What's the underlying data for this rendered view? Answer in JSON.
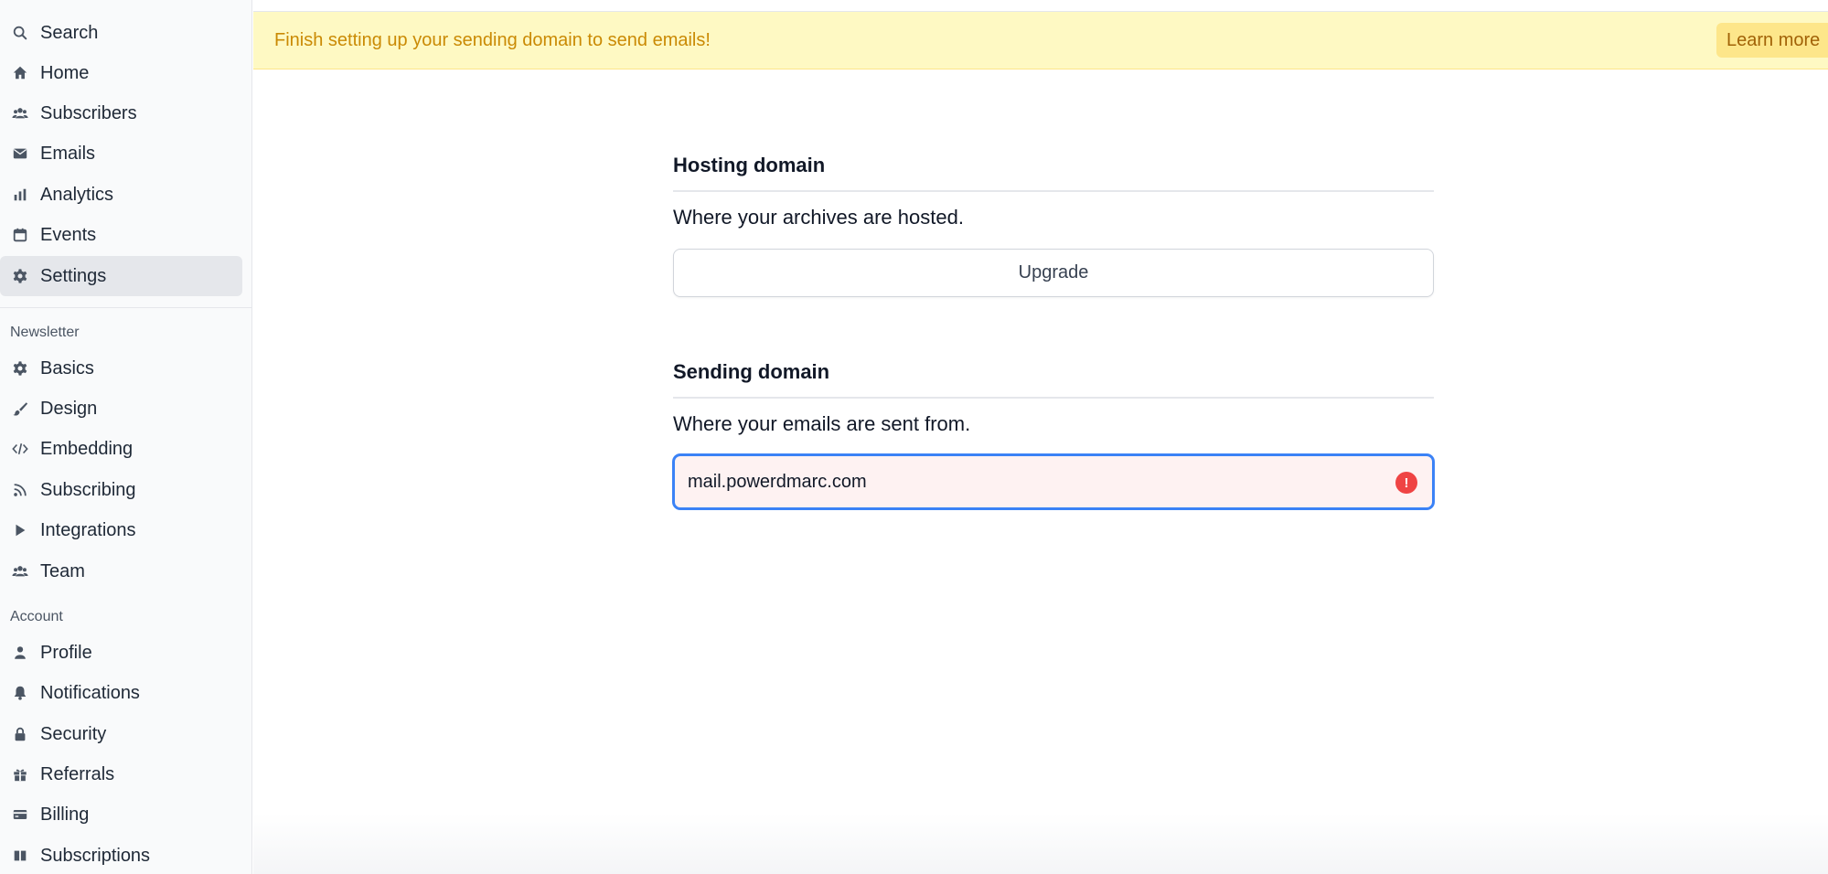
{
  "sidebar": {
    "main_items": [
      {
        "label": "Search",
        "icon": "search-icon"
      },
      {
        "label": "Home",
        "icon": "home-icon"
      },
      {
        "label": "Subscribers",
        "icon": "users-icon"
      },
      {
        "label": "Emails",
        "icon": "envelope-icon"
      },
      {
        "label": "Analytics",
        "icon": "bar-chart-icon"
      },
      {
        "label": "Events",
        "icon": "calendar-icon"
      },
      {
        "label": "Settings",
        "icon": "gear-icon",
        "active": true
      }
    ],
    "newsletter_heading": "Newsletter",
    "newsletter_items": [
      {
        "label": "Basics",
        "icon": "gear-icon"
      },
      {
        "label": "Design",
        "icon": "brush-icon"
      },
      {
        "label": "Embedding",
        "icon": "code-icon"
      },
      {
        "label": "Subscribing",
        "icon": "rss-icon"
      },
      {
        "label": "Integrations",
        "icon": "play-icon"
      },
      {
        "label": "Team",
        "icon": "users-icon"
      }
    ],
    "account_heading": "Account",
    "account_items": [
      {
        "label": "Profile",
        "icon": "user-icon"
      },
      {
        "label": "Notifications",
        "icon": "bell-icon"
      },
      {
        "label": "Security",
        "icon": "lock-icon"
      },
      {
        "label": "Referrals",
        "icon": "gift-icon"
      },
      {
        "label": "Billing",
        "icon": "credit-card-icon"
      },
      {
        "label": "Subscriptions",
        "icon": "columns-icon"
      }
    ]
  },
  "banner": {
    "message": "Finish setting up your sending domain to send emails!",
    "button_label": "Learn more"
  },
  "hosting": {
    "title": "Hosting domain",
    "description": "Where your archives are hosted.",
    "button_label": "Upgrade"
  },
  "sending": {
    "title": "Sending domain",
    "description": "Where your emails are sent from.",
    "input_value": "mail.powerdmarc.com",
    "error_icon": "exclamation-circle-icon"
  },
  "colors": {
    "banner_bg": "#fef9c3",
    "banner_text": "#ca8a04",
    "focus_border": "#3b82f6",
    "error": "#ef4444"
  }
}
